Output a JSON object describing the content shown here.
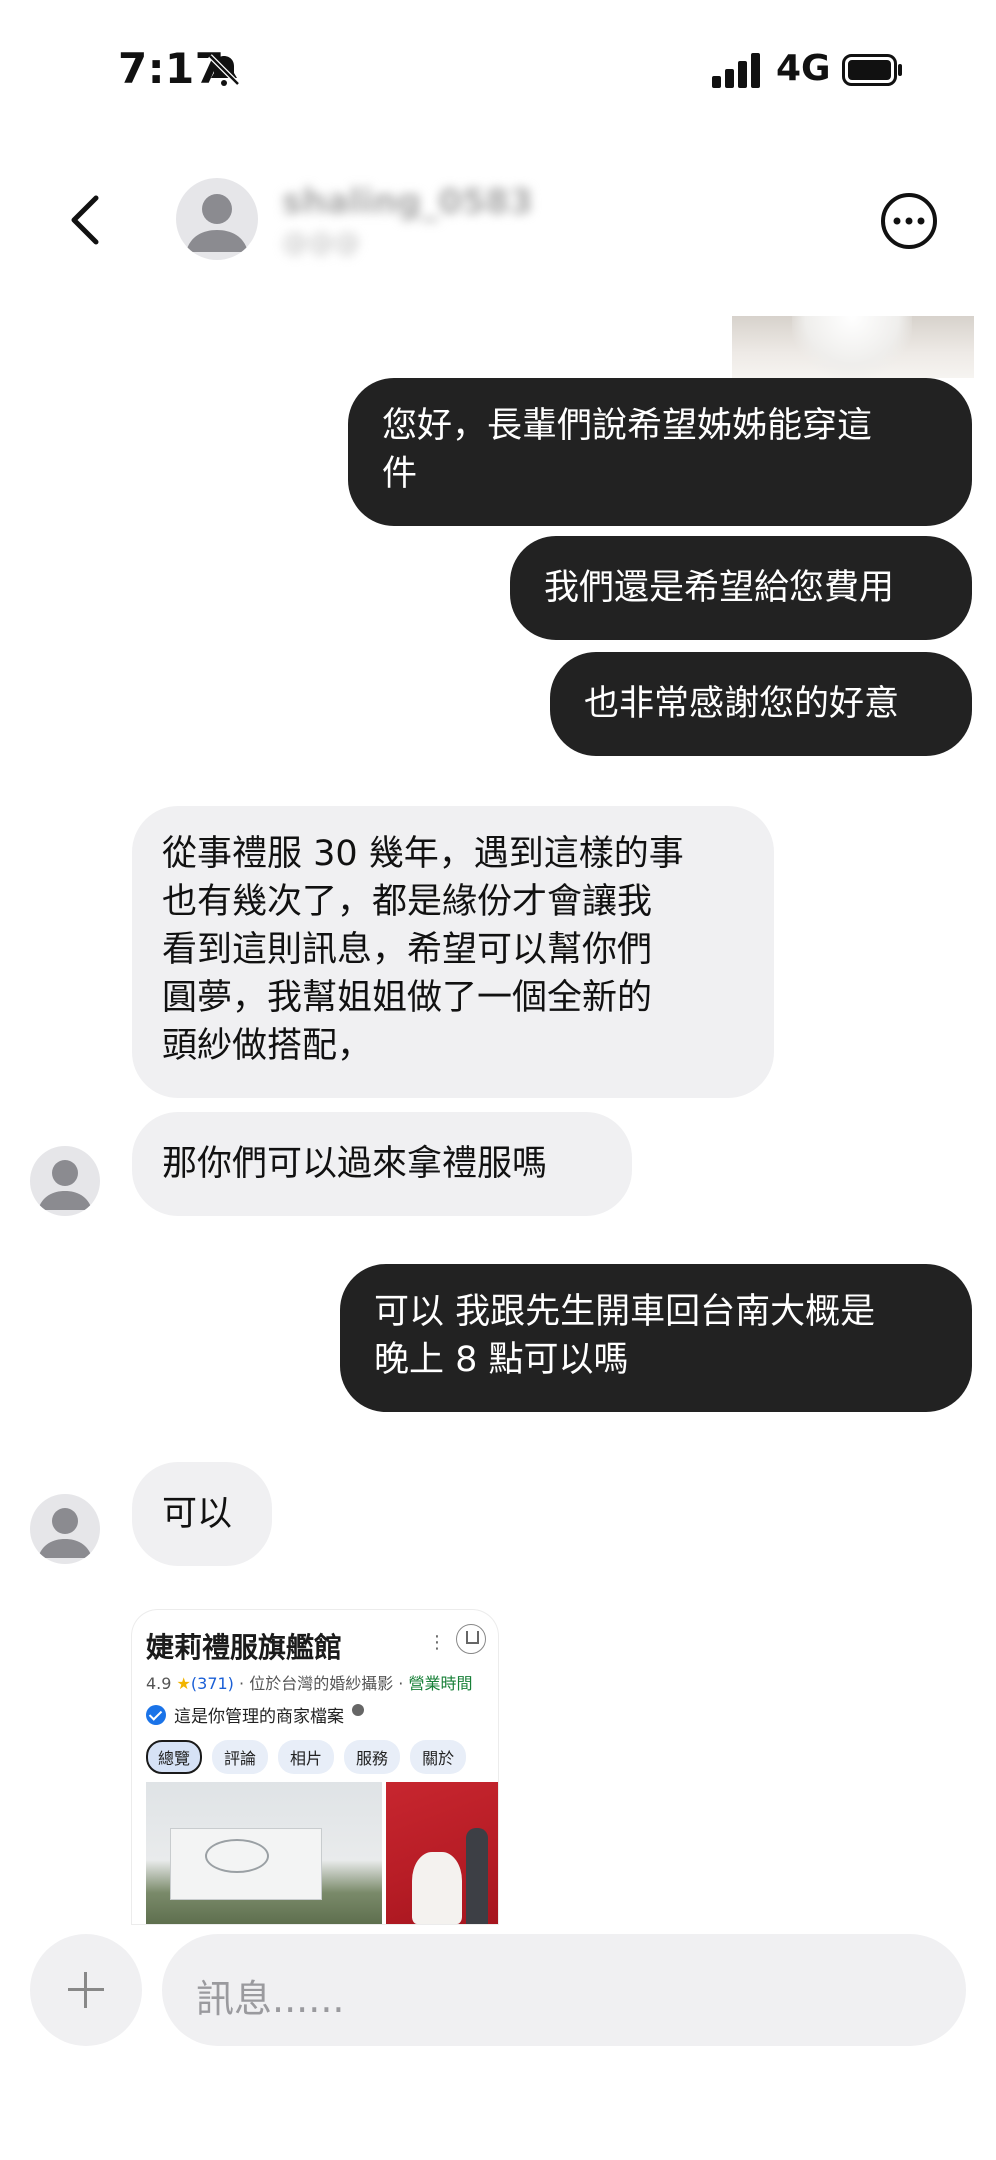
{
  "status_bar": {
    "time": "7:17",
    "network": "4G",
    "icons": [
      "bell-slash-icon",
      "cellular-signal-icon",
      "battery-icon"
    ]
  },
  "header": {
    "username": "shaling_0583",
    "subtitle": "@@@",
    "back_icon": "chevron-left-icon",
    "more_icon": "more-options-icon"
  },
  "messages": [
    {
      "from": "me",
      "text": "您好，長輩們說希望姊姊能穿這\n件"
    },
    {
      "from": "me",
      "text": "我們還是希望給您費用"
    },
    {
      "from": "me",
      "text": "也非常感謝您的好意"
    },
    {
      "from": "them",
      "text": "從事禮服 30 幾年，遇到這樣的事\n也有幾次了，都是緣份才會讓我\n看到這則訊息，希望可以幫你們\n圓夢，我幫姐姐做了一個全新的\n頭紗做搭配，"
    },
    {
      "from": "them",
      "text": "那你們可以過來拿禮服嗎"
    },
    {
      "from": "me",
      "text": "可以 我跟先生開車回台南大概是\n晚上 8 點可以嗎"
    },
    {
      "from": "them",
      "text": "可以"
    }
  ],
  "shared_card": {
    "title": "婕莉禮服旗艦館",
    "rating": "4.9",
    "star": "★",
    "review_count": "(371)",
    "category": "· 位於台灣的婚紗攝影 ·",
    "hours": "營業時間",
    "verified_text": "這是你管理的商家檔案",
    "tabs": [
      "總覽",
      "評論",
      "相片",
      "服務",
      "關於"
    ]
  },
  "composer": {
    "placeholder": "訊息......"
  },
  "colors": {
    "outgoing_bubble": "#222222",
    "incoming_bubble": "#f0f0f2",
    "background": "#ffffff"
  }
}
